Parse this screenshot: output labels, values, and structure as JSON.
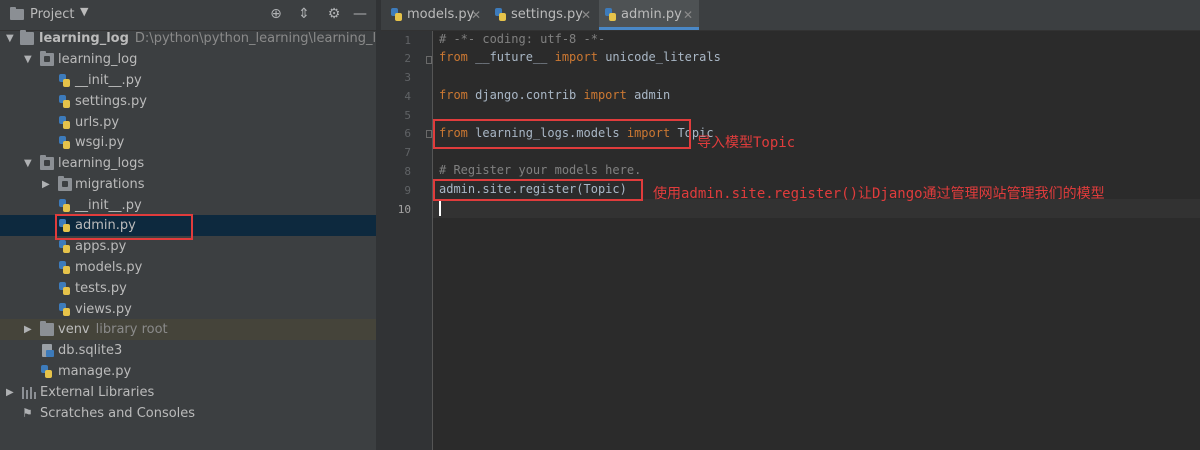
{
  "sidebar": {
    "title": "Project",
    "header_icons": [
      "target-icon",
      "collapse-icon",
      "gear-icon",
      "hide-icon"
    ],
    "tree": [
      {
        "label": "learning_log",
        "path": "D:\\python\\python_learning\\learning_log"
      },
      {
        "label": "learning_log"
      },
      {
        "label": "__init__.py"
      },
      {
        "label": "settings.py"
      },
      {
        "label": "urls.py"
      },
      {
        "label": "wsgi.py"
      },
      {
        "label": "learning_logs"
      },
      {
        "label": "migrations"
      },
      {
        "label": "__init__.py"
      },
      {
        "label": "admin.py"
      },
      {
        "label": "apps.py"
      },
      {
        "label": "models.py"
      },
      {
        "label": "tests.py"
      },
      {
        "label": "views.py"
      },
      {
        "label": "venv",
        "note": "library root"
      },
      {
        "label": "db.sqlite3"
      },
      {
        "label": "manage.py"
      },
      {
        "label": "External Libraries"
      },
      {
        "label": "Scratches and Consoles"
      }
    ]
  },
  "tabs": [
    {
      "label": "models.py"
    },
    {
      "label": "settings.py"
    },
    {
      "label": "admin.py",
      "active": true
    }
  ],
  "editor": {
    "line_numbers": [
      "1",
      "2",
      "3",
      "4",
      "5",
      "6",
      "7",
      "8",
      "9",
      "10"
    ],
    "lines": {
      "l1": "# -*- coding: utf-8 -*-",
      "l2_kw1": "from",
      "l2_mod": " __future__ ",
      "l2_kw2": "import",
      "l2_name": " unicode_literals",
      "l4_kw1": "from",
      "l4_mod": " django.contrib ",
      "l4_kw2": "import",
      "l4_name": " admin",
      "l6_kw1": "from",
      "l6_mod": " learning_logs.models ",
      "l6_kw2": "import",
      "l6_name": " Topic",
      "l8": "# Register your models here.",
      "l9": "admin.site.register(Topic)"
    }
  },
  "annotations": {
    "import_note": "导入模型Topic",
    "register_note": "使用admin.site.register()让Django通过管理网站管理我们的模型"
  },
  "colors": {
    "annotation": "#e03c3c",
    "keyword": "#cc7832",
    "comment": "#808080",
    "selection": "#0d293e"
  }
}
